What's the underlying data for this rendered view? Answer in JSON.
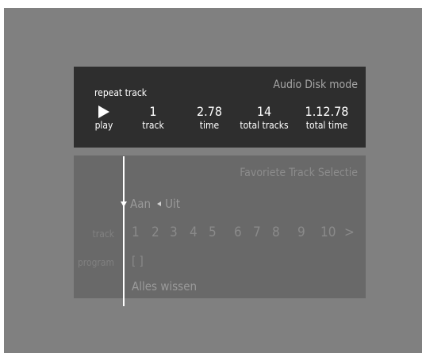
{
  "status": {
    "mode": "Audio Disk mode",
    "repeat": "repeat track",
    "play_icon": "play-icon",
    "play_label": "play",
    "track_value": "1",
    "track_label": "track",
    "time_value": "2.78",
    "time_label": "time",
    "total_tracks_value": "14",
    "total_tracks_label": "total tracks",
    "total_time_value": "1.12.78",
    "total_time_label": "total time"
  },
  "favorites": {
    "title": "Favoriete Track Selectie",
    "on_label": "Aan",
    "off_label": "Uit",
    "track_label": "track",
    "tracks": [
      "1",
      "2",
      "3",
      "4",
      "5",
      "6",
      "7",
      "8",
      "9",
      "10"
    ],
    "next_symbol": ">",
    "program_label": "program",
    "program_value": "[ ]",
    "clear_all": "Alles wissen"
  },
  "colors": {
    "screen_bg": "#808080",
    "status_bg": "#2e2e2e",
    "fav_bg": "#696969",
    "text_white": "#ffffff",
    "text_dim": "#8a8a8a"
  }
}
